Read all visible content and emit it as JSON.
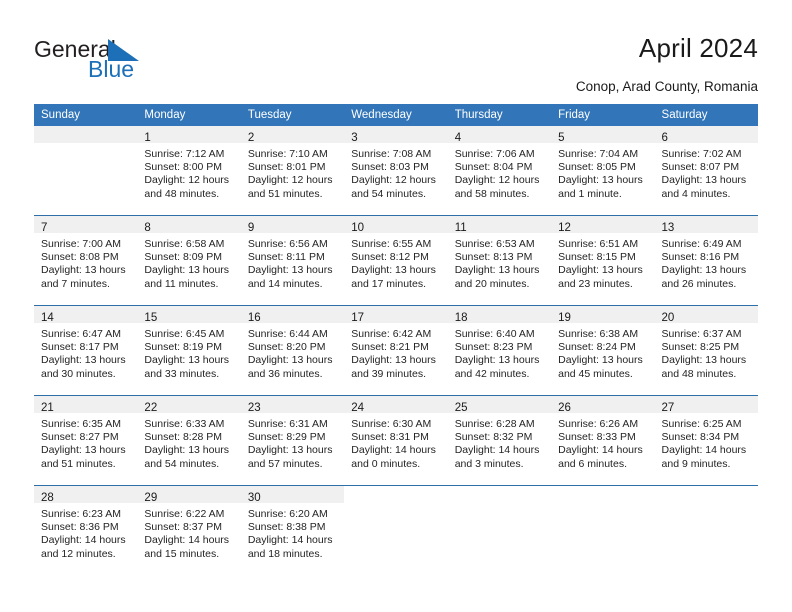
{
  "brand": {
    "name_part1": "General",
    "name_part2": "Blue",
    "logo_icon": "blue-triangle-mark",
    "accent_color": "#1d70b8"
  },
  "header": {
    "title": "April 2024",
    "subtitle": "Conop, Arad County, Romania"
  },
  "theme": {
    "header_row_bg": "#3275b8",
    "date_band_bg": "#f0f0f0",
    "row_divider": "#2f6fa8",
    "text_color": "#242424"
  },
  "calendar": {
    "weekday_headers": [
      "Sunday",
      "Monday",
      "Tuesday",
      "Wednesday",
      "Thursday",
      "Friday",
      "Saturday"
    ],
    "weeks": [
      [
        {
          "day": "",
          "empty": true,
          "sunrise": "",
          "sunset": "",
          "daylight_line1": "",
          "daylight_line2": ""
        },
        {
          "day": "1",
          "sunrise": "Sunrise: 7:12 AM",
          "sunset": "Sunset: 8:00 PM",
          "daylight_line1": "Daylight: 12 hours",
          "daylight_line2": "and 48 minutes."
        },
        {
          "day": "2",
          "sunrise": "Sunrise: 7:10 AM",
          "sunset": "Sunset: 8:01 PM",
          "daylight_line1": "Daylight: 12 hours",
          "daylight_line2": "and 51 minutes."
        },
        {
          "day": "3",
          "sunrise": "Sunrise: 7:08 AM",
          "sunset": "Sunset: 8:03 PM",
          "daylight_line1": "Daylight: 12 hours",
          "daylight_line2": "and 54 minutes."
        },
        {
          "day": "4",
          "sunrise": "Sunrise: 7:06 AM",
          "sunset": "Sunset: 8:04 PM",
          "daylight_line1": "Daylight: 12 hours",
          "daylight_line2": "and 58 minutes."
        },
        {
          "day": "5",
          "sunrise": "Sunrise: 7:04 AM",
          "sunset": "Sunset: 8:05 PM",
          "daylight_line1": "Daylight: 13 hours",
          "daylight_line2": "and 1 minute."
        },
        {
          "day": "6",
          "sunrise": "Sunrise: 7:02 AM",
          "sunset": "Sunset: 8:07 PM",
          "daylight_line1": "Daylight: 13 hours",
          "daylight_line2": "and 4 minutes."
        }
      ],
      [
        {
          "day": "7",
          "sunrise": "Sunrise: 7:00 AM",
          "sunset": "Sunset: 8:08 PM",
          "daylight_line1": "Daylight: 13 hours",
          "daylight_line2": "and 7 minutes."
        },
        {
          "day": "8",
          "sunrise": "Sunrise: 6:58 AM",
          "sunset": "Sunset: 8:09 PM",
          "daylight_line1": "Daylight: 13 hours",
          "daylight_line2": "and 11 minutes."
        },
        {
          "day": "9",
          "sunrise": "Sunrise: 6:56 AM",
          "sunset": "Sunset: 8:11 PM",
          "daylight_line1": "Daylight: 13 hours",
          "daylight_line2": "and 14 minutes."
        },
        {
          "day": "10",
          "sunrise": "Sunrise: 6:55 AM",
          "sunset": "Sunset: 8:12 PM",
          "daylight_line1": "Daylight: 13 hours",
          "daylight_line2": "and 17 minutes."
        },
        {
          "day": "11",
          "sunrise": "Sunrise: 6:53 AM",
          "sunset": "Sunset: 8:13 PM",
          "daylight_line1": "Daylight: 13 hours",
          "daylight_line2": "and 20 minutes."
        },
        {
          "day": "12",
          "sunrise": "Sunrise: 6:51 AM",
          "sunset": "Sunset: 8:15 PM",
          "daylight_line1": "Daylight: 13 hours",
          "daylight_line2": "and 23 minutes."
        },
        {
          "day": "13",
          "sunrise": "Sunrise: 6:49 AM",
          "sunset": "Sunset: 8:16 PM",
          "daylight_line1": "Daylight: 13 hours",
          "daylight_line2": "and 26 minutes."
        }
      ],
      [
        {
          "day": "14",
          "sunrise": "Sunrise: 6:47 AM",
          "sunset": "Sunset: 8:17 PM",
          "daylight_line1": "Daylight: 13 hours",
          "daylight_line2": "and 30 minutes."
        },
        {
          "day": "15",
          "sunrise": "Sunrise: 6:45 AM",
          "sunset": "Sunset: 8:19 PM",
          "daylight_line1": "Daylight: 13 hours",
          "daylight_line2": "and 33 minutes."
        },
        {
          "day": "16",
          "sunrise": "Sunrise: 6:44 AM",
          "sunset": "Sunset: 8:20 PM",
          "daylight_line1": "Daylight: 13 hours",
          "daylight_line2": "and 36 minutes."
        },
        {
          "day": "17",
          "sunrise": "Sunrise: 6:42 AM",
          "sunset": "Sunset: 8:21 PM",
          "daylight_line1": "Daylight: 13 hours",
          "daylight_line2": "and 39 minutes."
        },
        {
          "day": "18",
          "sunrise": "Sunrise: 6:40 AM",
          "sunset": "Sunset: 8:23 PM",
          "daylight_line1": "Daylight: 13 hours",
          "daylight_line2": "and 42 minutes."
        },
        {
          "day": "19",
          "sunrise": "Sunrise: 6:38 AM",
          "sunset": "Sunset: 8:24 PM",
          "daylight_line1": "Daylight: 13 hours",
          "daylight_line2": "and 45 minutes."
        },
        {
          "day": "20",
          "sunrise": "Sunrise: 6:37 AM",
          "sunset": "Sunset: 8:25 PM",
          "daylight_line1": "Daylight: 13 hours",
          "daylight_line2": "and 48 minutes."
        }
      ],
      [
        {
          "day": "21",
          "sunrise": "Sunrise: 6:35 AM",
          "sunset": "Sunset: 8:27 PM",
          "daylight_line1": "Daylight: 13 hours",
          "daylight_line2": "and 51 minutes."
        },
        {
          "day": "22",
          "sunrise": "Sunrise: 6:33 AM",
          "sunset": "Sunset: 8:28 PM",
          "daylight_line1": "Daylight: 13 hours",
          "daylight_line2": "and 54 minutes."
        },
        {
          "day": "23",
          "sunrise": "Sunrise: 6:31 AM",
          "sunset": "Sunset: 8:29 PM",
          "daylight_line1": "Daylight: 13 hours",
          "daylight_line2": "and 57 minutes."
        },
        {
          "day": "24",
          "sunrise": "Sunrise: 6:30 AM",
          "sunset": "Sunset: 8:31 PM",
          "daylight_line1": "Daylight: 14 hours",
          "daylight_line2": "and 0 minutes."
        },
        {
          "day": "25",
          "sunrise": "Sunrise: 6:28 AM",
          "sunset": "Sunset: 8:32 PM",
          "daylight_line1": "Daylight: 14 hours",
          "daylight_line2": "and 3 minutes."
        },
        {
          "day": "26",
          "sunrise": "Sunrise: 6:26 AM",
          "sunset": "Sunset: 8:33 PM",
          "daylight_line1": "Daylight: 14 hours",
          "daylight_line2": "and 6 minutes."
        },
        {
          "day": "27",
          "sunrise": "Sunrise: 6:25 AM",
          "sunset": "Sunset: 8:34 PM",
          "daylight_line1": "Daylight: 14 hours",
          "daylight_line2": "and 9 minutes."
        }
      ],
      [
        {
          "day": "28",
          "sunrise": "Sunrise: 6:23 AM",
          "sunset": "Sunset: 8:36 PM",
          "daylight_line1": "Daylight: 14 hours",
          "daylight_line2": "and 12 minutes."
        },
        {
          "day": "29",
          "sunrise": "Sunrise: 6:22 AM",
          "sunset": "Sunset: 8:37 PM",
          "daylight_line1": "Daylight: 14 hours",
          "daylight_line2": "and 15 minutes."
        },
        {
          "day": "30",
          "sunrise": "Sunrise: 6:20 AM",
          "sunset": "Sunset: 8:38 PM",
          "daylight_line1": "Daylight: 14 hours",
          "daylight_line2": "and 18 minutes."
        },
        {
          "day": "",
          "empty": true,
          "blank": true,
          "sunrise": "",
          "sunset": "",
          "daylight_line1": "",
          "daylight_line2": ""
        },
        {
          "day": "",
          "empty": true,
          "blank": true,
          "sunrise": "",
          "sunset": "",
          "daylight_line1": "",
          "daylight_line2": ""
        },
        {
          "day": "",
          "empty": true,
          "blank": true,
          "sunrise": "",
          "sunset": "",
          "daylight_line1": "",
          "daylight_line2": ""
        },
        {
          "day": "",
          "empty": true,
          "blank": true,
          "sunrise": "",
          "sunset": "",
          "daylight_line1": "",
          "daylight_line2": ""
        }
      ]
    ]
  }
}
